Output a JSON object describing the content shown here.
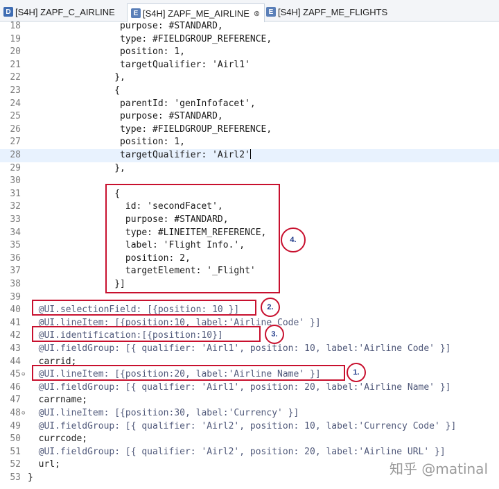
{
  "tabs": [
    {
      "icon_letter": "D",
      "icon_color": "#3f6db3",
      "label": "[S4H] ZAPF_C_AIRLINE",
      "active": false
    },
    {
      "icon_letter": "E",
      "icon_color": "#5a7fb8",
      "label": "[S4H] ZAPF_ME_AIRLINE",
      "active": true,
      "close": "⊗"
    },
    {
      "icon_letter": "E",
      "icon_color": "#5a7fb8",
      "label": "[S4H] ZAPF_ME_FLIGHTS",
      "active": false
    }
  ],
  "lines": [
    {
      "n": "18",
      "text": "                 purpose: #STANDARD,"
    },
    {
      "n": "19",
      "text": "                 type: #FIELDGROUP_REFERENCE,"
    },
    {
      "n": "20",
      "text": "                 position: 1,"
    },
    {
      "n": "21",
      "text": "                 targetQualifier: 'Airl1'"
    },
    {
      "n": "22",
      "text": "                },"
    },
    {
      "n": "23",
      "text": "                {"
    },
    {
      "n": "24",
      "text": "                 parentId: 'genInfofacet',"
    },
    {
      "n": "25",
      "text": "                 purpose: #STANDARD,"
    },
    {
      "n": "26",
      "text": "                 type: #FIELDGROUP_REFERENCE,"
    },
    {
      "n": "27",
      "text": "                 position: 1,"
    },
    {
      "n": "28",
      "text": "                 targetQualifier: 'Airl2'",
      "current": true
    },
    {
      "n": "29",
      "text": "                },"
    },
    {
      "n": "30",
      "text": ""
    },
    {
      "n": "31",
      "text": "                {"
    },
    {
      "n": "32",
      "text": "                  id: 'secondFacet',"
    },
    {
      "n": "33",
      "text": "                  purpose: #STANDARD,"
    },
    {
      "n": "34",
      "text": "                  type: #LINEITEM_REFERENCE,"
    },
    {
      "n": "35",
      "text": "                  label: 'Flight Info.',"
    },
    {
      "n": "36",
      "text": "                  position: 2,"
    },
    {
      "n": "37",
      "text": "                  targetElement: '_Flight'"
    },
    {
      "n": "38",
      "text": "                }]"
    },
    {
      "n": "39",
      "text": ""
    },
    {
      "n": "40",
      "text": "  @UI.selectionField: [{position: 10 }]"
    },
    {
      "n": "41",
      "text": "  @UI.lineItem: [{position:10, label:'Airline Code' }]"
    },
    {
      "n": "42",
      "text": "  @UI.identification:[{position:10}]"
    },
    {
      "n": "43",
      "text": "  @UI.fieldGroup: [{ qualifier: 'Airl1', position: 10, label:'Airline Code' }]"
    },
    {
      "n": "44",
      "text": "  carrid;"
    },
    {
      "n": "45",
      "text": "  @UI.lineItem: [{position:20, label:'Airline Name' }]",
      "fold": "⊖"
    },
    {
      "n": "46",
      "text": "  @UI.fieldGroup: [{ qualifier: 'Airl1', position: 20, label:'Airline Name' }]"
    },
    {
      "n": "47",
      "text": "  carrname;"
    },
    {
      "n": "48",
      "text": "  @UI.lineItem: [{position:30, label:'Currency' }]",
      "fold": "⊖"
    },
    {
      "n": "49",
      "text": "  @UI.fieldGroup: [{ qualifier: 'Airl2', position: 10, label:'Currency Code' }]"
    },
    {
      "n": "50",
      "text": "  currcode;"
    },
    {
      "n": "51",
      "text": "  @UI.fieldGroup: [{ qualifier: 'Airl2', position: 20, label:'Airline URL' }]"
    },
    {
      "n": "52",
      "text": "  url;"
    },
    {
      "n": "53",
      "text": "}"
    }
  ],
  "callouts": [
    "4.",
    "2.",
    "3.",
    "1."
  ],
  "watermark": "知乎 @matinal",
  "colors": {
    "highlight_box": "#c8102e",
    "callout_text": "#1f3a8a",
    "current_line": "#e8f2fe"
  }
}
